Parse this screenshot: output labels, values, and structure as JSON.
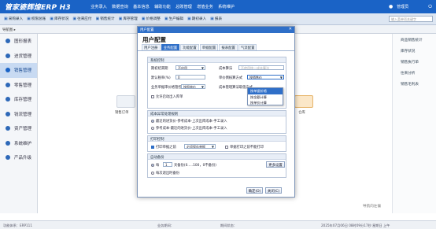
{
  "app": {
    "brand": "管家婆辉煌ERP H3",
    "user": "管理员",
    "menus": [
      "业务录入",
      "数据查询",
      "基本信息",
      "辅助功能",
      "总账管理",
      "增值业务",
      "系统维护"
    ]
  },
  "toolbar": {
    "items": [
      {
        "label": "采购录入",
        "icon": "▣"
      },
      {
        "label": "权限总账",
        "icon": "▣"
      },
      {
        "label": "库存状况",
        "icon": "▣"
      },
      {
        "label": "往来应付",
        "icon": "▣"
      },
      {
        "label": "销售统计",
        "icon": "▣"
      },
      {
        "label": "库存管理",
        "icon": "▣"
      },
      {
        "label": "价格调整",
        "icon": "▣"
      },
      {
        "label": "生产编辑",
        "icon": "▣"
      },
      {
        "label": "期初录入",
        "icon": "▣"
      },
      {
        "label": "报表",
        "icon": "▣"
      }
    ],
    "search_placeholder": "输入菜单项关键字"
  },
  "subbar": {
    "tag": "导航图 ▸"
  },
  "sidebar": {
    "items": [
      "图形报表",
      "进货管理",
      "销售管理",
      "零售管理",
      "库存管理",
      "钱流管理",
      "资产管理",
      "系统维护",
      "产品升级"
    ],
    "active_index": 2
  },
  "content": {
    "labels": [
      "销售订单",
      "仓库"
    ]
  },
  "rightpanel": {
    "items": [
      "商品销售统计",
      "库存状况",
      "销售执行单",
      "往来分析",
      "销售毛利表"
    ]
  },
  "helper": "导航向左偏",
  "statusbar": {
    "items": [
      "功能体系：ERP111",
      "业务期间：",
      "期间状态：",
      "2025年07月06日 08时09分17秒 星期日 上午"
    ]
  },
  "dialog": {
    "title": "用户配置",
    "header": "用户配置",
    "close": "✕",
    "tabs": [
      "用户注册",
      "业务配置",
      "功能配置",
      "单据配置",
      "报表配置",
      "气流配置"
    ],
    "active_tab": 1,
    "sec1": {
      "title": "系统控制",
      "f1_label": "期初结束期",
      "f1_value": "不启用",
      "f2_label": "成本算法",
      "f2_value": "不使用统一成本算法",
      "f3_label": "默认税率(%)",
      "f3_value": "0",
      "f4_label": "单价倒核算方式",
      "f4_value": "按销售价",
      "f5_label": "业务单据审价格管控",
      "f5_value": "按照单价",
      "f6_label": "成本管理算法取值方式",
      "cb_label": "允许启动出入库单"
    },
    "dropdown": {
      "options": [
        "按单据价格",
        "按金额计算",
        "按单价计算"
      ],
      "selected": 0
    },
    "sec2": {
      "title": "成本异常处理规则",
      "r1": "最近的进货价-参考成本-上次出库成本-手工录入",
      "r2": "参考成本-最近的进货价-上次出库成本-手工录入"
    },
    "sec3": {
      "title": "打印控制",
      "cb1": "打印单据之前",
      "sel": "必须保存单据",
      "cb2": "单据打印之前不能打印"
    },
    "sec4": {
      "title": "自动备份",
      "r1_a": "每",
      "r1_value": "1",
      "r1_b": "天备份(0.....100，0不备份)",
      "btn": "更多设置",
      "r2": "每次退出时备份"
    },
    "ok": "确定(O)",
    "cancel": "关闭(C)"
  }
}
